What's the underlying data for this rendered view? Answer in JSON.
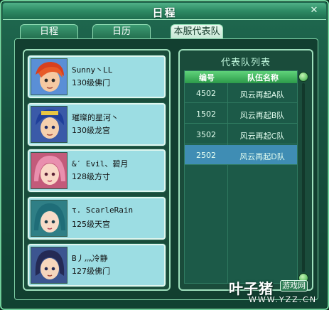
{
  "window": {
    "title": "日程",
    "close": "✕"
  },
  "tabs": [
    {
      "label": "日程"
    },
    {
      "label": "日历"
    },
    {
      "label": "本服代表队",
      "active": true
    }
  ],
  "members": [
    {
      "name": "Sunny丶LL",
      "level": "130级佛门",
      "avatar": "red-haired-boy"
    },
    {
      "name": "璀璨的星河丶",
      "level": "130级龙宫",
      "avatar": "blue-haired-prince"
    },
    {
      "name": "&′ Evil、碧月",
      "level": "128级方寸",
      "avatar": "pink-haired-girl"
    },
    {
      "name": "τ. ScarleRain",
      "level": "125级天宫",
      "avatar": "teal-haired-girl"
    },
    {
      "name": "B丿灬冷静",
      "level": "127级佛门",
      "avatar": "dark-haired-woman"
    }
  ],
  "team_list": {
    "title": "代表队列表",
    "headers": {
      "id": "编号",
      "name": "队伍名称"
    },
    "rows": [
      {
        "id": "4502",
        "name": "风云再起A队",
        "selected": false
      },
      {
        "id": "1502",
        "name": "风云再起B队",
        "selected": false
      },
      {
        "id": "3502",
        "name": "风云再起C队",
        "selected": false
      },
      {
        "id": "2502",
        "name": "风云再起D队",
        "selected": true
      }
    ]
  },
  "watermark": {
    "brand": "叶子猪",
    "badge": "游戏网",
    "url": "WWW.YZZ.CN"
  },
  "colors": {
    "accent": "#6fcf9a",
    "member_bg": "#9cdde3",
    "selected_row": "#3f8db4"
  }
}
